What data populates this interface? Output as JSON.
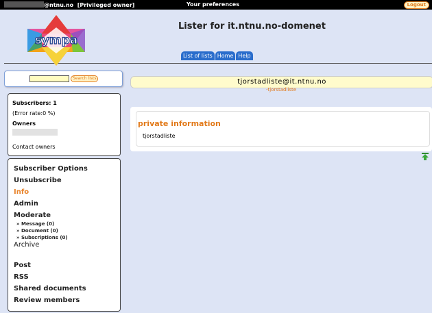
{
  "topbar": {
    "user": "@ntnu.no",
    "role": "[Privileged owner]",
    "preferences": "Your preferences",
    "logout": "Logout"
  },
  "header": {
    "logo_text": "sympa",
    "title": "Lister for it.ntnu.no-domenet",
    "tabs": [
      "List of lists",
      "Home",
      "Help"
    ]
  },
  "search": {
    "button": "Search lists"
  },
  "list_info": {
    "subscribers": "Subscribers: 1",
    "error_rate": "(Error rate:0 %)",
    "owners_label": "Owners",
    "contact": "Contact owners"
  },
  "menu": {
    "items": [
      "Subscriber Options",
      "Unsubscribe",
      "Info",
      "Admin",
      "Moderate"
    ],
    "moderate_sub": [
      "Message (0)",
      "Document (0)",
      "Subscriptions (0)"
    ],
    "archive": "Archive",
    "items2": [
      "Post",
      "RSS",
      "Shared documents",
      "Review members"
    ]
  },
  "list": {
    "address": "tjorstadliste@it.ntnu.no",
    "subject": "-tjorstadliste"
  },
  "content": {
    "heading": "private information",
    "text": "tjorstadliste"
  },
  "colors": {
    "accent": "#e27a1a",
    "tab": "#2a6dcc",
    "background": "#dde4f5"
  }
}
